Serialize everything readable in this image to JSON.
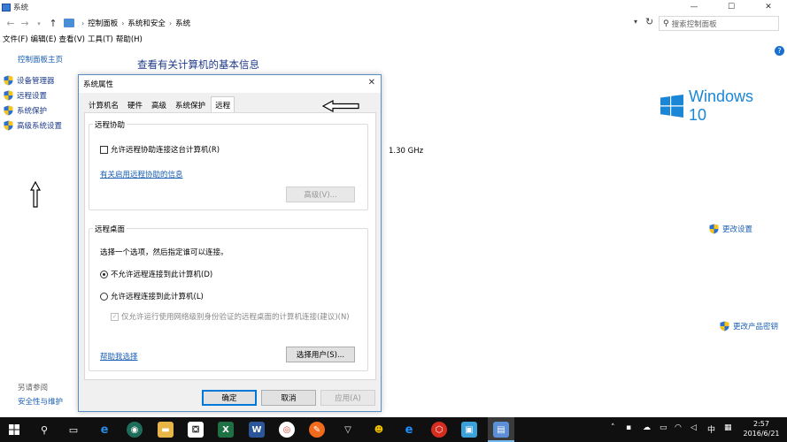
{
  "window": {
    "title": "系统",
    "min": "—",
    "max": "☐",
    "close": "✕"
  },
  "address": {
    "crumbs": [
      "控制面板",
      "系统和安全",
      "系统"
    ],
    "search_placeholder": "搜索控制面板"
  },
  "menu": [
    "文件(F)",
    "编辑(E)",
    "查看(V)",
    "工具(T)",
    "帮助(H)"
  ],
  "sidebar": {
    "home": "控制面板主页",
    "items": [
      {
        "label": "设备管理器"
      },
      {
        "label": "远程设置"
      },
      {
        "label": "系统保护"
      },
      {
        "label": "高级系统设置"
      }
    ],
    "see_also": "另请参阅",
    "security": "安全性与维护"
  },
  "main": {
    "heading": "查看有关计算机的基本信息",
    "cpu_speed": "1.30 GHz",
    "windows_logo_text": "Windows 10",
    "change_settings": "更改设置",
    "change_product_key": "更改产品密钥",
    "help": "?"
  },
  "dialog": {
    "title": "系统属性",
    "close": "✕",
    "tabs": [
      "计算机名",
      "硬件",
      "高级",
      "系统保护",
      "远程"
    ],
    "active_tab": "远程",
    "assistance": {
      "title": "远程协助",
      "allow_checkbox": "允许远程协助连接这台计算机(R)",
      "allow_checked": false,
      "info_link": "有关启用远程协助的信息",
      "advanced_button": "高级(V)..."
    },
    "desktop": {
      "title": "远程桌面",
      "prompt": "选择一个选项，然后指定谁可以连接。",
      "option_deny": "不允许远程连接到此计算机(D)",
      "option_allow": "允许远程连接到此计算机(L)",
      "selected": "deny",
      "nla_checkbox": "仅允许运行使用网络级别身份验证的远程桌面的计算机连接(建议)(N)",
      "nla_checked": true,
      "help_link": "帮助我选择",
      "select_users_button": "选择用户(S)..."
    },
    "ok": "确定",
    "cancel": "取消",
    "apply": "应用(A)"
  },
  "taskbar": {
    "ime": "中",
    "time": "2:57",
    "date": "2016/6/21"
  },
  "colors": {
    "accent": "#0078d7",
    "link": "#1a5fb4",
    "heading": "#1e3a8a",
    "taskbar": "#101010"
  }
}
